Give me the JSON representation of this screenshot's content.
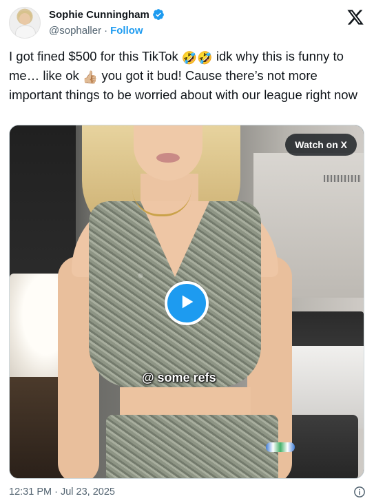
{
  "author": {
    "display_name": "Sophie Cunningham",
    "handle": "@sophaller",
    "separator": "·",
    "follow_label": "Follow"
  },
  "tweet": {
    "text_before_emoji": "I got fined $500 for this TikTok ",
    "emoji_1": "🤣🤣",
    "text_middle": "  idk why this is funny to me… like ok ",
    "emoji_2": "👍🏼",
    "text_after": " you got it bud! Cause there’s not more important things to be worried about with our league right now"
  },
  "media": {
    "watch_label": "Watch on X",
    "caption": "@ some refs",
    "accent_color": "#1d9bf0"
  },
  "footer": {
    "timestamp": "12:31 PM · Jul 23, 2025"
  },
  "icons": {
    "brand": "x-logo-icon",
    "verified": "verified-badge-icon",
    "play": "play-icon",
    "info": "info-icon"
  }
}
